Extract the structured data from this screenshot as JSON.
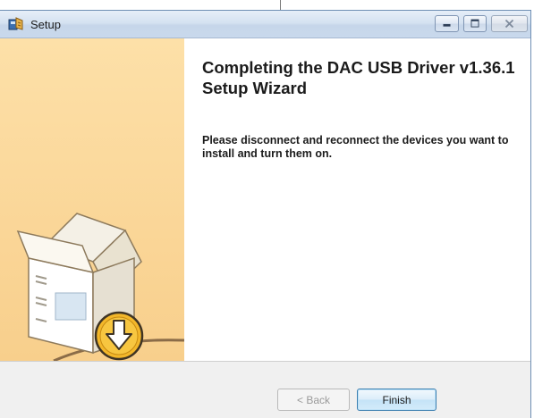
{
  "window": {
    "title": "Setup",
    "icon": "setup-installer-icon",
    "controls": {
      "minimize": "minimize-icon",
      "maximize": "maximize-icon",
      "close": "close-icon"
    }
  },
  "wizard": {
    "heading": "Completing the DAC USB Driver v1.36.1 Setup Wizard",
    "message": "Please disconnect and reconnect the devices you want to install and turn them on.",
    "side_graphic": "software-box-install-icon"
  },
  "buttons": {
    "back_label": "< Back",
    "finish_label": "Finish"
  },
  "colors": {
    "side_panel": "#fbd99d",
    "titlebar": "#d5e2f1",
    "footer": "#f0f0f0"
  }
}
